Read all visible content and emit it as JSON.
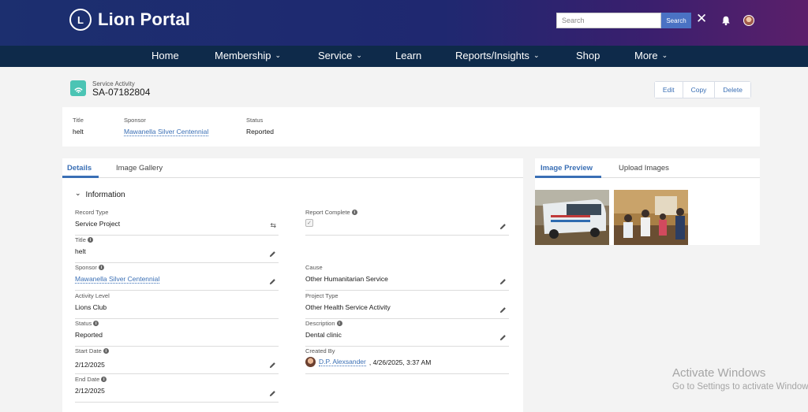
{
  "header": {
    "logo_text": "Lion Portal",
    "logo_mark": "L",
    "search": {
      "placeholder": "Search",
      "button_label": "Search"
    },
    "close_label": "✕"
  },
  "nav": {
    "items": [
      {
        "label": "Home",
        "has_menu": false
      },
      {
        "label": "Membership",
        "has_menu": true
      },
      {
        "label": "Service",
        "has_menu": true
      },
      {
        "label": "Learn",
        "has_menu": false
      },
      {
        "label": "Reports/Insights",
        "has_menu": true
      },
      {
        "label": "Shop",
        "has_menu": false
      },
      {
        "label": "More",
        "has_menu": true
      }
    ],
    "chevron": "⌄"
  },
  "record": {
    "object_type": "Service Activity",
    "name": "SA-07182804",
    "actions": [
      "Edit",
      "Copy",
      "Delete"
    ]
  },
  "highlights": {
    "title_label": "Title",
    "title_value": "helt",
    "sponsor_label": "Sponsor",
    "sponsor_value": "Mawanella Silver Centennial",
    "status_label": "Status",
    "status_value": "Reported"
  },
  "left_tabs": [
    "Details",
    "Image Gallery"
  ],
  "section": {
    "title": "Information",
    "chevron": "⌄"
  },
  "fields": {
    "record_type": {
      "label": "Record Type",
      "value": "Service Project"
    },
    "report_complete": {
      "label": "Report Complete",
      "checked": true
    },
    "title": {
      "label": "Title",
      "value": "helt"
    },
    "sponsor": {
      "label": "Sponsor",
      "value": "Mawanella Silver Centennial"
    },
    "cause": {
      "label": "Cause",
      "value": "Other Humanitarian Service"
    },
    "activity_level": {
      "label": "Activity Level",
      "value": "Lions Club"
    },
    "project_type": {
      "label": "Project Type",
      "value": "Other Health Service Activity"
    },
    "status": {
      "label": "Status",
      "value": "Reported"
    },
    "description": {
      "label": "Description",
      "value": "Dental clinic"
    },
    "start_date": {
      "label": "Start Date",
      "value": "2/12/2025"
    },
    "created_by": {
      "label": "Created By",
      "user": "D.P. Alexsander",
      "timestamp": ", 4/26/2025, 3:37 AM"
    },
    "end_date": {
      "label": "End Date",
      "value": "2/12/2025"
    }
  },
  "right_tabs": [
    "Image Preview",
    "Upload Images"
  ],
  "watermark": {
    "line1": "Activate Windows",
    "line2": "Go to Settings to activate Windows."
  },
  "colors": {
    "brand_dark": "#0e2a4a",
    "link": "#3a6fb5",
    "accent_teal": "#4bc4b4"
  }
}
